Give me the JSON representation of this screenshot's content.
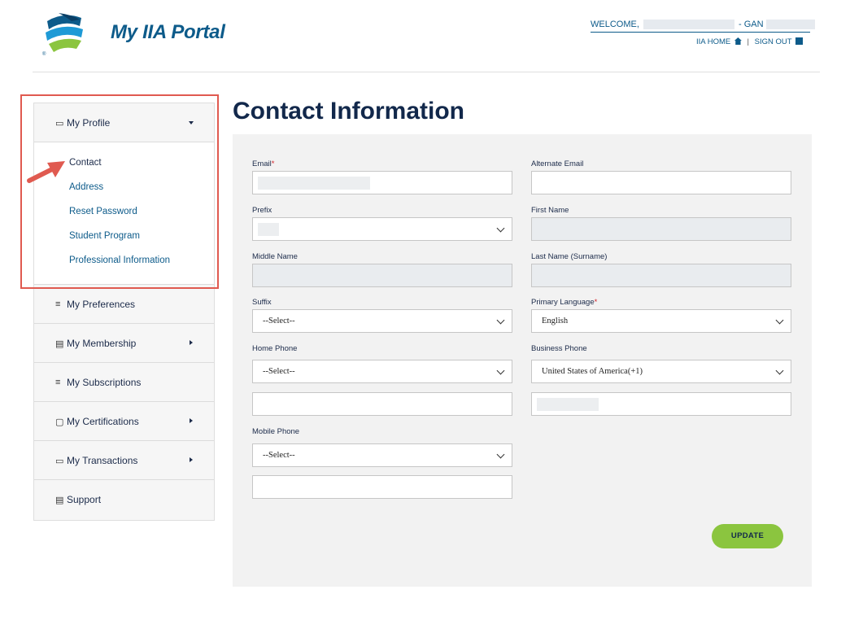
{
  "app": {
    "title": "My IIA Portal"
  },
  "header": {
    "welcome_prefix": "WELCOME,",
    "welcome_mid": "- GAN",
    "links": {
      "home": "IIA HOME",
      "separator": "|",
      "signout": "SIGN OUT"
    }
  },
  "sidebar": {
    "items": [
      {
        "label": "My Profile",
        "icon": "profile-card-icon",
        "expanded": true
      },
      {
        "label": "My Preferences",
        "icon": "sliders-icon"
      },
      {
        "label": "My Membership",
        "icon": "membership-icon",
        "has_submenu": true
      },
      {
        "label": "My Subscriptions",
        "icon": "sliders-icon"
      },
      {
        "label": "My Certifications",
        "icon": "certificate-icon",
        "has_submenu": true
      },
      {
        "label": "My Transactions",
        "icon": "folder-icon",
        "has_submenu": true
      },
      {
        "label": "Support",
        "icon": "chat-icon"
      }
    ],
    "profile_submenu": [
      "Contact",
      "Address",
      "Reset Password",
      "Student Program",
      "Professional Information"
    ],
    "active_submenu": "Contact"
  },
  "main": {
    "title": "Contact Information",
    "fields": {
      "email": {
        "label": "Email",
        "required": "*"
      },
      "alternate_email": {
        "label": "Alternate Email"
      },
      "prefix": {
        "label": "Prefix"
      },
      "first_name": {
        "label": "First Name"
      },
      "middle_name": {
        "label": "Middle Name"
      },
      "last_name": {
        "label": "Last Name (Surname)"
      },
      "suffix": {
        "label": "Suffix",
        "value": "--Select--"
      },
      "primary_language": {
        "label": "Primary Language",
        "required": "*",
        "value": "English"
      },
      "home_phone": {
        "label": "Home Phone",
        "country": "--Select--"
      },
      "business_phone": {
        "label": "Business Phone",
        "country": "United States of America(+1)"
      },
      "mobile_phone": {
        "label": "Mobile Phone",
        "country": "--Select--"
      }
    },
    "update_label": "UPDATE"
  },
  "colors": {
    "brand_blue": "#0d5b8a",
    "title_navy": "#12284b",
    "accent_green": "#8bc53f",
    "annotation_red": "#e05a50"
  }
}
